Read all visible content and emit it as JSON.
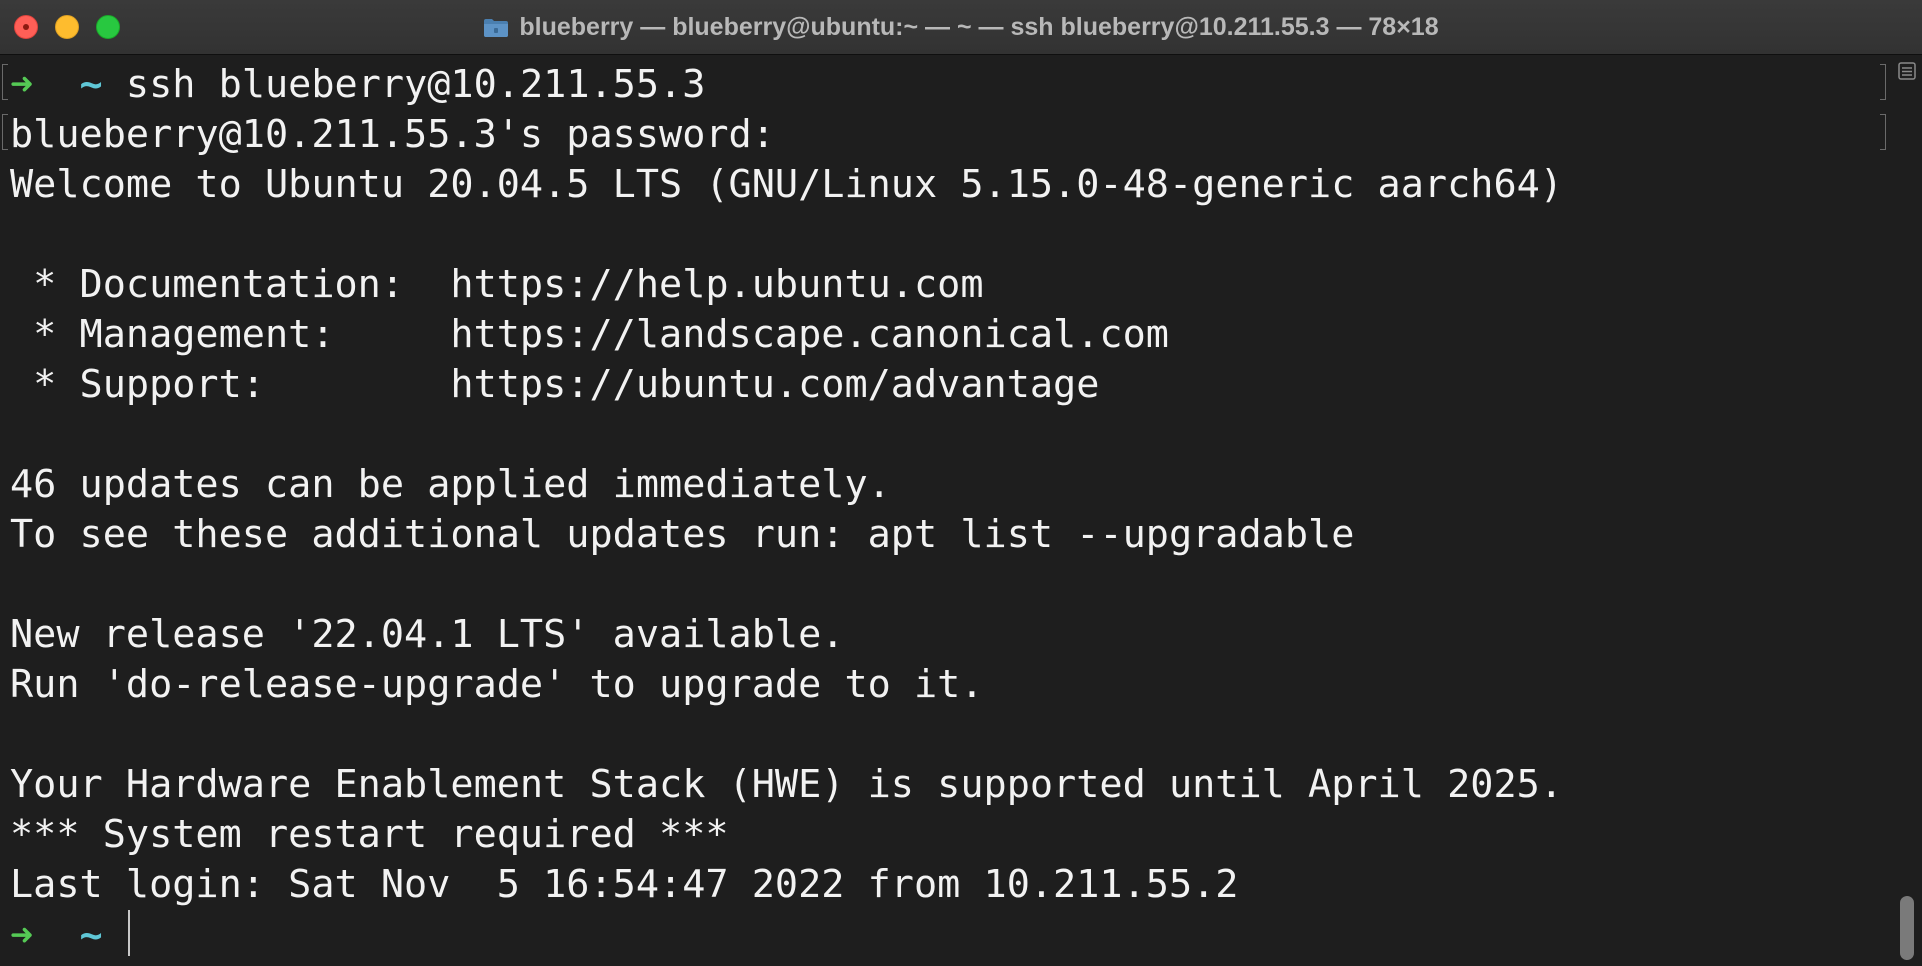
{
  "window": {
    "title": "blueberry — blueberry@ubuntu:~ — ~ — ssh blueberry@10.211.55.3 — 78×18"
  },
  "traffic_lights": {
    "close_icon": "close-icon",
    "minimize_icon": "minimize-icon",
    "zoom_icon": "zoom-icon",
    "colors": {
      "close": "#ff5f57",
      "minimize": "#febc2e",
      "zoom": "#28c840"
    }
  },
  "terminal": {
    "prompt_arrow": "➜",
    "prompt_dir": "~",
    "command": "ssh blueberry@10.211.55.3",
    "lines": [
      "blueberry@10.211.55.3's password:",
      "Welcome to Ubuntu 20.04.5 LTS (GNU/Linux 5.15.0-48-generic aarch64)",
      "",
      " * Documentation:  https://help.ubuntu.com",
      " * Management:     https://landscape.canonical.com",
      " * Support:        https://ubuntu.com/advantage",
      "",
      "46 updates can be applied immediately.",
      "To see these additional updates run: apt list --upgradable",
      "",
      "New release '22.04.1 LTS' available.",
      "Run 'do-release-upgrade' to upgrade to it.",
      "",
      "Your Hardware Enablement Stack (HWE) is supported until April 2025.",
      "*** System restart required ***",
      "Last login: Sat Nov  5 16:54:47 2022 from 10.211.55.2"
    ],
    "colors": {
      "background": "#1e1e1e",
      "text": "#f2f2f2",
      "arrow": "#55c955",
      "tilde": "#5fc7d6"
    }
  }
}
